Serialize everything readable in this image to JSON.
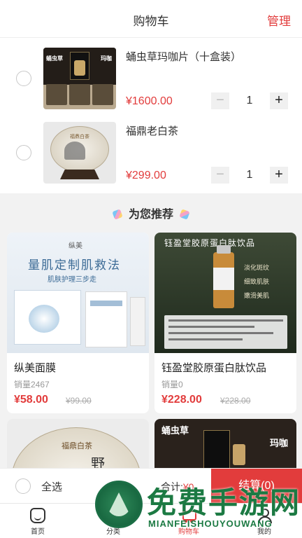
{
  "header": {
    "title": "购物车",
    "manage_label": "管理"
  },
  "cart": {
    "items": [
      {
        "name": "蛹虫草玛咖片（十盒装）",
        "price": "¥1600.00",
        "qty": "1",
        "thumb_texts": [
          "蛹虫草",
          "玛咖"
        ]
      },
      {
        "name": "福鼎老白茶",
        "price": "¥299.00",
        "qty": "1",
        "thumb_texts": [
          "福鼎白茶"
        ]
      }
    ]
  },
  "recommend": {
    "title": "为您推荐",
    "cards": [
      {
        "name": "纵美面膜",
        "sales": "销量2467",
        "price": "¥58.00",
        "orig_price": "¥99.00",
        "img_texts": {
          "brand": "纵美",
          "headline": "量肌定制肌救法",
          "sub": "肌肤护理三步走"
        }
      },
      {
        "name": "钰盈堂胶原蛋白肽饮品",
        "sales": "销量0",
        "price": "¥228.00",
        "orig_price": "¥228.00",
        "img_texts": {
          "title": "钰盈堂胶原蛋白肽饮品",
          "tags": [
            "淡化斑纹",
            "细致肌肤",
            "嫩滑美肌"
          ]
        }
      },
      {
        "img_texts": {
          "title": "福鼎白茶",
          "ink": "野"
        }
      },
      {
        "img_texts": {
          "left": "蛹虫草",
          "right": "玛咖"
        }
      }
    ]
  },
  "bottom": {
    "select_all": "全选",
    "total_label": "合计:",
    "total_amount": "¥0",
    "checkout": "结算(0)"
  },
  "tabs": [
    {
      "label": "首页",
      "icon": "home-icon"
    },
    {
      "label": "分类",
      "icon": "category-icon"
    },
    {
      "label": "购物车",
      "icon": "cart-icon"
    },
    {
      "label": "我的",
      "icon": "user-icon"
    }
  ],
  "watermark": {
    "text": "免费手游网",
    "sub": "MIANFEISHOUYOUWANG"
  },
  "colors": {
    "accent": "#e23c3c"
  }
}
